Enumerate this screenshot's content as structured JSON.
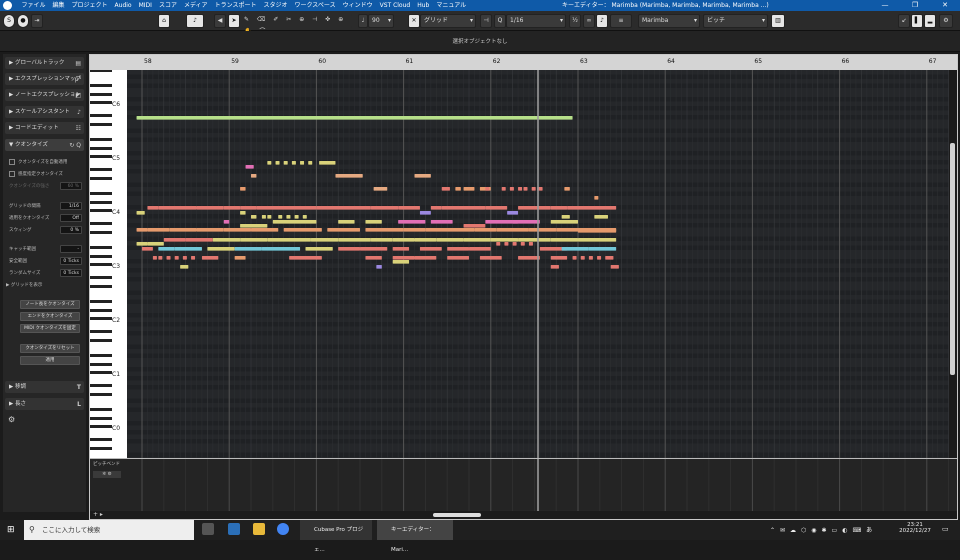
{
  "window": {
    "title": "キーエディター： Marimba (Marimba, Marimba, Marimba, Marimba ...)",
    "menu": [
      "ファイル",
      "編集",
      "プロジェクト",
      "Audio",
      "MIDI",
      "スコア",
      "メディア",
      "トランスポート",
      "スタジオ",
      "ワークスペース",
      "ウィンドウ",
      "VST Cloud",
      "Hub",
      "マニュアル"
    ],
    "controls": [
      "—",
      "❐",
      "✕"
    ]
  },
  "toolbar": {
    "velocity": "90",
    "grid_type": "グリッド",
    "quantize": "1/16",
    "instrument": "Marimba",
    "expression": "ビッチ"
  },
  "infobar": {
    "message": "選択オブジェクトなし"
  },
  "inspector": {
    "sections": [
      {
        "label": "グローバルトラック"
      },
      {
        "label": "エクスプレッションマップ"
      },
      {
        "label": "ノートエクスプレッション"
      },
      {
        "label": "スケールアシスタント"
      },
      {
        "label": "コードエディット"
      },
      {
        "label": "クオンタイズ"
      }
    ],
    "quantize": {
      "auto_apply": "クオンタイズを自動適用",
      "sensitive": "感度指定クオンタイズ",
      "sensitive_amount_label": "クオンタイズの強さ",
      "sensitive_amount": "60 %",
      "grid_label": "グリッドの間隔",
      "grid": "1/16",
      "iq_label": "適用をクオンタイズ",
      "iq": "Off",
      "swing_label": "スウィング",
      "swing": "0 %",
      "catch_label": "キャッチ範囲",
      "catch": "-",
      "safe_label": "安全範囲",
      "safe": "0 Ticks",
      "random_label": "ランダムサイズ",
      "random": "0 Ticks",
      "show_grid": "グリッドを表示",
      "btn_note_len": "ノート長をクオンタイズ",
      "btn_end": "エンドをクオンタイズ",
      "btn_midi": "MIDI クオンタイズを固定",
      "btn_reset": "クオンタイズをリセット",
      "btn_apply": "適用"
    },
    "bottom_sections": [
      {
        "label": "移調"
      },
      {
        "label": "長さ"
      }
    ]
  },
  "editor": {
    "bars": [
      "58",
      "59",
      "60",
      "61",
      "62",
      "63",
      "64",
      "65",
      "66",
      "67"
    ],
    "octaves": [
      "C6",
      "C5",
      "C4",
      "C3",
      "C2",
      "C1",
      "C0"
    ],
    "velocity_lane_label": "ピッチベンド",
    "note_colors": {
      "green": "#b7e08a",
      "orange": "#e69a6c",
      "pink": "#e26fb5",
      "salmon": "#e2776f",
      "yellow": "#d9d27a",
      "cyan": "#72c7d8",
      "lavender": "#9b88e0",
      "peach": "#e5a981"
    }
  },
  "taskbar": {
    "search": "ここに入力して検索",
    "app1": "Cubase Pro プロジェ...",
    "app2": "キーエディター： Mari...",
    "time": "23:21",
    "date": "2022/12/27"
  }
}
